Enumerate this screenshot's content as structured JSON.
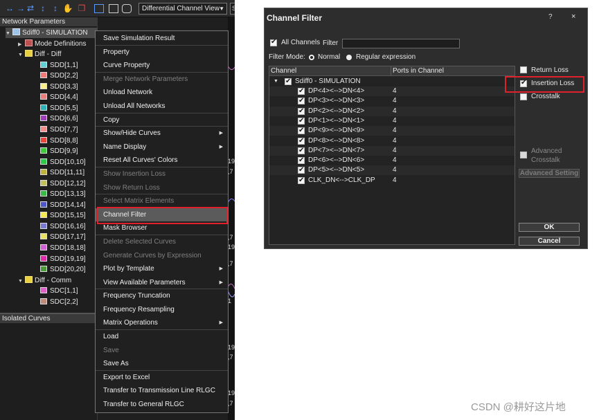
{
  "toolbar": {
    "view_select": "Differential Channel View",
    "icons": [
      "arrows-left-right-icon",
      "arrows-in-icon",
      "arrows-out-icon",
      "arrow-up-down-icon",
      "arrow-up-down-2-icon",
      "hand-icon",
      "overlay-icon",
      "rect-select-icon",
      "grid-icon",
      "ring-icon"
    ],
    "accent": "#5a9bff"
  },
  "network_panel": {
    "header": "Network Parameters",
    "root": "Sdiff0 - SIMULATION",
    "mode_definitions": "Mode Definitions",
    "group1": "Diff - Diff",
    "sdd": [
      {
        "label": "SDD[1,1]",
        "color": "#5fd0d6"
      },
      {
        "label": "SDD[2,2]",
        "color": "#f07a7a"
      },
      {
        "label": "SDD[3,3]",
        "color": "#f6ef8a"
      },
      {
        "label": "SDD[4,4]",
        "color": "#e97d7d"
      },
      {
        "label": "SDD[5,5]",
        "color": "#2eb3b8"
      },
      {
        "label": "SDD[6,6]",
        "color": "#a03db8"
      },
      {
        "label": "SDD[7,7]",
        "color": "#f08c8c"
      },
      {
        "label": "SDD[8,8]",
        "color": "#e8453c"
      },
      {
        "label": "SDD[9,9]",
        "color": "#3ec93c"
      },
      {
        "label": "SDD[10,10]",
        "color": "#2fc94a"
      },
      {
        "label": "SDD[11,11]",
        "color": "#c0b040"
      },
      {
        "label": "SDD[12,12]",
        "color": "#c4c060"
      },
      {
        "label": "SDD[13,13]",
        "color": "#3ab84a"
      },
      {
        "label": "SDD[14,14]",
        "color": "#4e56c8"
      },
      {
        "label": "SDD[15,15]",
        "color": "#f5e850"
      },
      {
        "label": "SDD[16,16]",
        "color": "#7a7ad0"
      },
      {
        "label": "SDD[17,17]",
        "color": "#e8e060"
      },
      {
        "label": "SDD[18,18]",
        "color": "#d060d6"
      },
      {
        "label": "SDD[19,19]",
        "color": "#e02aa8"
      },
      {
        "label": "SDD[20,20]",
        "color": "#4a9a3a"
      }
    ],
    "group2": "Diff - Comm",
    "sdc": [
      {
        "label": "SDC[1,1]",
        "color": "#e060c8"
      },
      {
        "label": "SDC[2,2]",
        "color": "#c08a7a"
      }
    ]
  },
  "isolated_panel": {
    "header": "Isolated Curves"
  },
  "plot_strip_labels": [
    "19,",
    ",7",
    ",7",
    "19,",
    ",7",
    "1",
    "19,",
    ",7",
    "19,",
    ",7"
  ],
  "context_menu": [
    {
      "label": "Save Simulation Result",
      "enabled": true,
      "submenu": false,
      "sep": true
    },
    {
      "label": "Property",
      "enabled": true,
      "submenu": false
    },
    {
      "label": "Curve Property",
      "enabled": true,
      "submenu": false,
      "sep": true
    },
    {
      "label": "Merge Network Parameters",
      "enabled": false,
      "submenu": false
    },
    {
      "label": "Unload Network",
      "enabled": true,
      "submenu": false
    },
    {
      "label": "Unload All Networks",
      "enabled": true,
      "submenu": false,
      "sep": true
    },
    {
      "label": "Copy",
      "enabled": true,
      "submenu": false,
      "sep": true
    },
    {
      "label": "Show/Hide Curves",
      "enabled": true,
      "submenu": true
    },
    {
      "label": "Name Display",
      "enabled": true,
      "submenu": true
    },
    {
      "label": "Reset All Curves' Colors",
      "enabled": true,
      "submenu": false,
      "sep": true
    },
    {
      "label": "Show Insertion Loss",
      "enabled": false,
      "submenu": false
    },
    {
      "label": "Show Return Loss",
      "enabled": false,
      "submenu": false,
      "sep": true
    },
    {
      "label": "Select Matrix Elements",
      "enabled": false,
      "submenu": false
    },
    {
      "label": "Channel Filter",
      "enabled": true,
      "submenu": false,
      "highlight": true
    },
    {
      "label": "Mask Browser",
      "enabled": true,
      "submenu": false,
      "sep": true
    },
    {
      "label": "Delete Selected Curves",
      "enabled": false,
      "submenu": false
    },
    {
      "label": "Generate Curves by Expression",
      "enabled": false,
      "submenu": false
    },
    {
      "label": "Plot by Template",
      "enabled": true,
      "submenu": true
    },
    {
      "label": "View Available Parameters",
      "enabled": true,
      "submenu": true,
      "sep": true
    },
    {
      "label": "Frequency Truncation",
      "enabled": true,
      "submenu": false
    },
    {
      "label": "Frequency Resampling",
      "enabled": true,
      "submenu": false
    },
    {
      "label": "Matrix Operations",
      "enabled": true,
      "submenu": true,
      "sep": true
    },
    {
      "label": "Load",
      "enabled": true,
      "submenu": false
    },
    {
      "label": "Save",
      "enabled": false,
      "submenu": false
    },
    {
      "label": "Save As",
      "enabled": true,
      "submenu": false,
      "sep": true
    },
    {
      "label": "Export to Excel",
      "enabled": true,
      "submenu": false
    },
    {
      "label": "Transfer to Transmission Line RLGC",
      "enabled": true,
      "submenu": false
    },
    {
      "label": "Transfer to General RLGC",
      "enabled": true,
      "submenu": false
    }
  ],
  "dialog": {
    "title": "Channel Filter",
    "help": "?",
    "close": "×",
    "all_channels": "All Channels",
    "filter_label": "Filter",
    "filter_value": "",
    "filter_mode_label": "Filter Mode:",
    "mode_normal": "Normal",
    "mode_regex": "Regular expression",
    "col_channel": "Channel",
    "col_ports": "Ports in Channel",
    "root_label": "Sdiff0 - SIMULATION",
    "channels": [
      {
        "name": "DP<4><-->DN<4>",
        "ports": "4"
      },
      {
        "name": "DP<3><-->DN<3>",
        "ports": "4"
      },
      {
        "name": "DP<2><-->DN<2>",
        "ports": "4"
      },
      {
        "name": "DP<1><-->DN<1>",
        "ports": "4"
      },
      {
        "name": "DP<9><-->DN<9>",
        "ports": "4"
      },
      {
        "name": "DP<8><-->DN<8>",
        "ports": "4"
      },
      {
        "name": "DP<7><-->DN<7>",
        "ports": "4"
      },
      {
        "name": "DP<6><-->DN<6>",
        "ports": "4"
      },
      {
        "name": "DP<5><-->DN<5>",
        "ports": "4"
      },
      {
        "name": "CLK_DN<-->CLK_DP",
        "ports": "4"
      }
    ],
    "return_loss": "Return Loss",
    "insertion_loss": "Insertion Loss",
    "crosstalk": "Crosstalk",
    "advanced_crosstalk_1": "Advanced",
    "advanced_crosstalk_2": "Crosstalk",
    "advanced_setting": "Advanced Setting",
    "ok": "OK",
    "cancel": "Cancel"
  },
  "highlight_color": "#e0212b",
  "watermark": "CSDN @耕好这片地"
}
